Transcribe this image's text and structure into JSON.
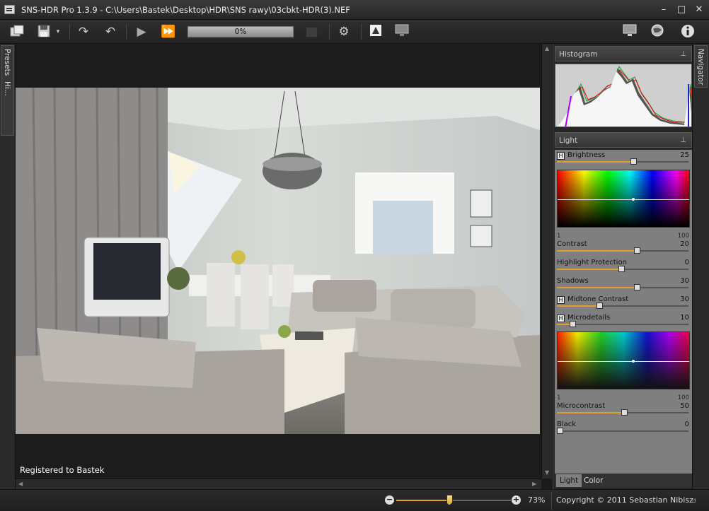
{
  "window": {
    "title": "SNS-HDR Pro 1.3.9 - C:\\Users\\Bastek\\Desktop\\HDR\\SNS rawy\\03cbkt-HDR(3).NEF"
  },
  "toolbar": {
    "progress_label": "0%",
    "progress": 0.0
  },
  "left_panel": {
    "tab_label": "Presets",
    "tab2_label": "Hi..."
  },
  "canvas": {
    "registered_text": "Registered to Bastek"
  },
  "histogram": {
    "title": "Histogram"
  },
  "light": {
    "title": "Light",
    "brightness": {
      "label": "Brightness",
      "value": "25",
      "level": 0.58
    },
    "grad1_min": "1",
    "grad1_max": "100",
    "contrast": {
      "label": "Contrast",
      "value": "20",
      "level": 0.61
    },
    "highlight_protection": {
      "label": "Highlight Protection",
      "value": "0",
      "level": 0.49
    },
    "shadows": {
      "label": "Shadows",
      "value": "30",
      "level": 0.61
    },
    "midtone_contrast": {
      "label": "Midtone Contrast",
      "value": "30",
      "level": 0.32
    },
    "microdetails": {
      "label": "Microdetails",
      "value": "10",
      "level": 0.12
    },
    "grad2_min": "1",
    "grad2_max": "100",
    "microcontrast": {
      "label": "Microcontrast",
      "value": "50",
      "level": 0.51
    },
    "black": {
      "label": "Black",
      "value": "0",
      "level": 0.02
    }
  },
  "tabs": [
    {
      "label": "Light"
    },
    {
      "label": "Color"
    }
  ],
  "navigator": {
    "tab_label": "Navigator"
  },
  "status": {
    "zoom_value": "73%",
    "zoom_level": 0.46,
    "copyright": "Copyright © 2011 Sebastian Nibisz"
  },
  "colors": {
    "accent": "#e39d2c"
  }
}
